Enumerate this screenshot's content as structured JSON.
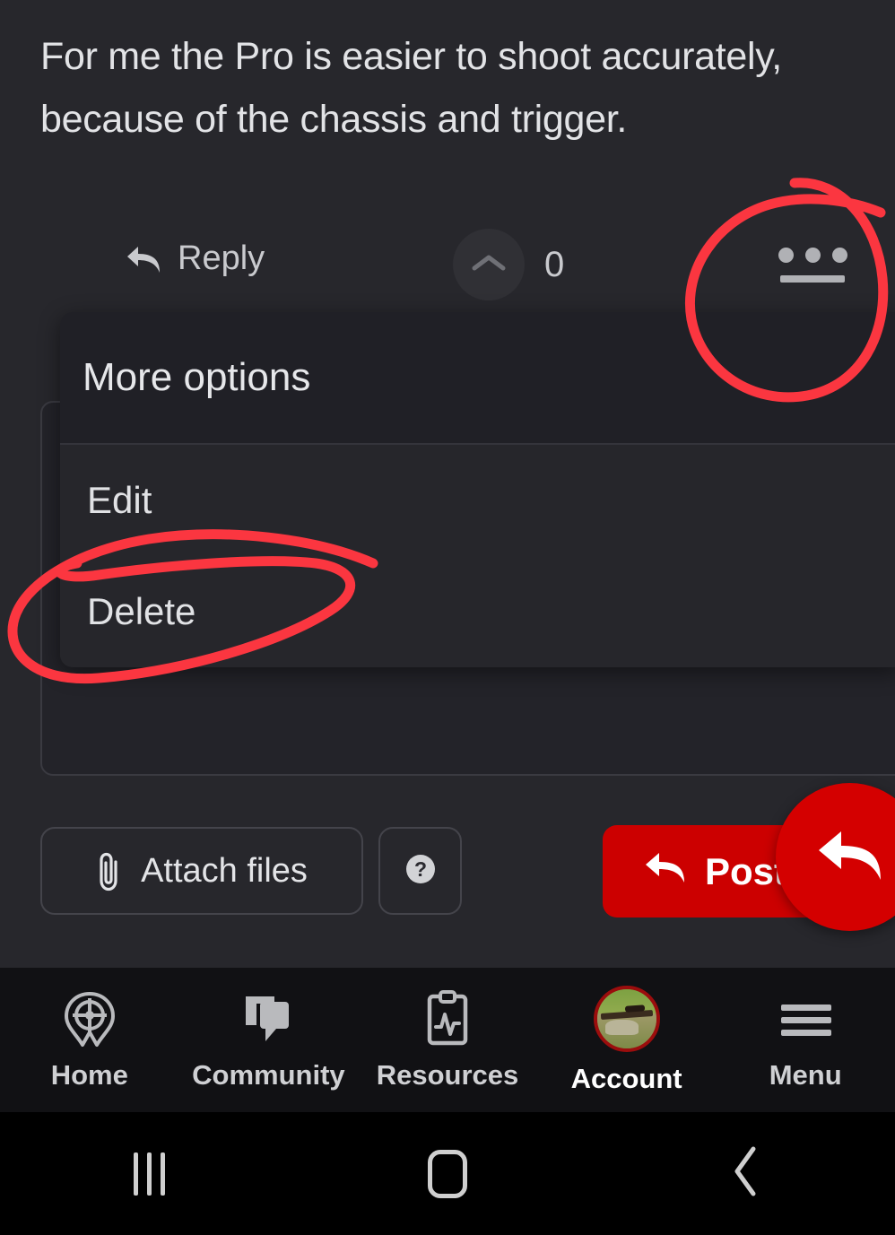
{
  "comment": {
    "line_1": "For me the Pro is easier to shoot accurately,",
    "line_2": "because of the chassis and trigger."
  },
  "actions": {
    "reply_label": "Reply",
    "reply_icon": "reply-arrow-icon",
    "upvote_icon": "chevron-up-icon",
    "vote_count": "0",
    "more_options_icon": "ellipsis-icon"
  },
  "more_options_menu": {
    "title": "More options",
    "items": [
      {
        "label": "Edit",
        "name": "menu-item-edit"
      },
      {
        "label": "Delete",
        "name": "menu-item-delete"
      }
    ]
  },
  "composer": {
    "attach_label": "Attach files",
    "attach_icon": "paperclip-icon",
    "help_icon": "question-mark-icon",
    "post_label": "Post",
    "post_icon": "reply-arrow-icon",
    "fab_icon": "reply-arrow-icon"
  },
  "bottom_nav": {
    "items": [
      {
        "label": "Home",
        "icon": "crosshair-pin-icon",
        "active": false
      },
      {
        "label": "Community",
        "icon": "chat-bubbles-icon",
        "active": false
      },
      {
        "label": "Resources",
        "icon": "clipboard-chart-icon",
        "active": false
      },
      {
        "label": "Account",
        "icon": "user-avatar-icon",
        "active": true
      },
      {
        "label": "Menu",
        "icon": "hamburger-icon",
        "active": false
      }
    ]
  },
  "system_nav": {
    "recents_icon": "recents-icon",
    "home_icon": "home-square-icon",
    "back_icon": "back-chevron-icon"
  },
  "annotations": {
    "ink_color": "#fb3640",
    "circled_more_options": true,
    "circled_delete": true
  },
  "colors": {
    "page_background": "#27272c",
    "menu_header_background": "#202026",
    "menu_body_background": "#26262b",
    "accent_red": "#cc0000",
    "nav_background": "#111114"
  }
}
